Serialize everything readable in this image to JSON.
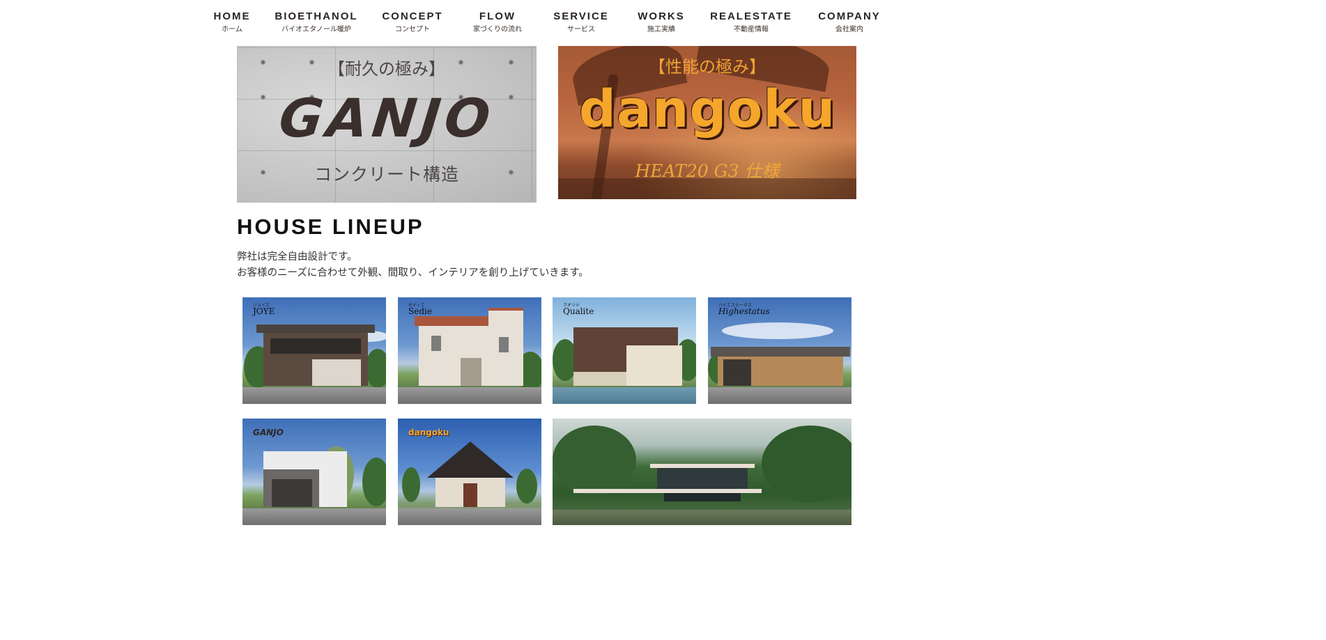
{
  "nav": {
    "items": [
      {
        "en": "HOME",
        "jp": "ホーム"
      },
      {
        "en": "BIOETHANOL",
        "jp": "バイオエタノール暖炉"
      },
      {
        "en": "CONCEPT",
        "jp": "コンセプト"
      },
      {
        "en": "FLOW",
        "jp": "家づくりの流れ"
      },
      {
        "en": "SERVICE",
        "jp": "サービス"
      },
      {
        "en": "WORKS",
        "jp": "施工実績"
      },
      {
        "en": "REALESTATE",
        "jp": "不動産情報"
      },
      {
        "en": "COMPANY",
        "jp": "会社案内"
      }
    ]
  },
  "banners": {
    "ganjo": {
      "top": "【耐久の極み】",
      "logo": "GANJO",
      "bottom": "コンクリート構造"
    },
    "dangoku": {
      "top": "【性能の極み】",
      "logo": "dangoku",
      "bottom": "HEAT20 G3 仕様"
    }
  },
  "lineup": {
    "title": "HOUSE LINEUP",
    "desc_line1": "弊社は完全自由設計です。",
    "desc_line2": "お客様のニーズに合わせて外観、間取り、インテリアを創り上げていきます。",
    "cards": [
      {
        "kana": "ジョイエ",
        "label": "JOYE"
      },
      {
        "kana": "セディエ",
        "label": "Sedie"
      },
      {
        "kana": "クオリテ",
        "label": "Qualite"
      },
      {
        "kana": "ハイエステータス",
        "label": "Highestatus"
      },
      {
        "kana": "",
        "label": "GANJO"
      },
      {
        "kana": "",
        "label": "dangoku"
      },
      {
        "kana": "",
        "label": ""
      }
    ]
  },
  "colors": {
    "nav_text": "#2b2321",
    "dangoku_orange": "#f5a62b",
    "ganjo_text": "#3a2f2c"
  }
}
